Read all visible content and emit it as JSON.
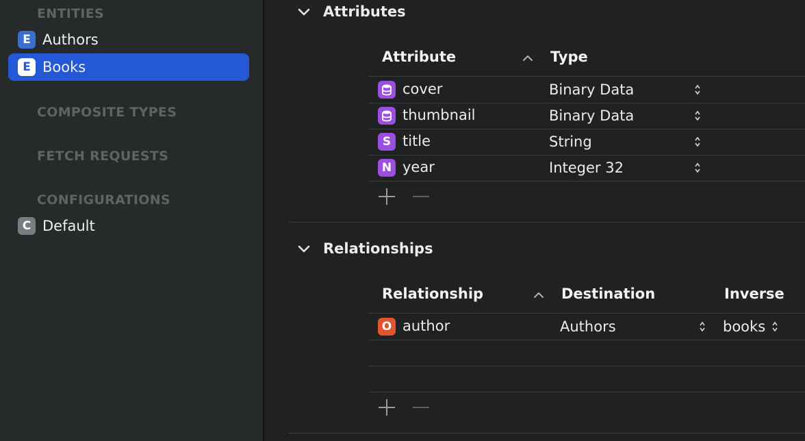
{
  "sidebar": {
    "entities_header": "ENTITIES",
    "entities": [
      {
        "label": "Authors",
        "badge": "E",
        "selected": false
      },
      {
        "label": "Books",
        "badge": "E",
        "selected": true
      }
    ],
    "composite_header": "COMPOSITE TYPES",
    "fetch_header": "FETCH REQUESTS",
    "configurations_header": "CONFIGURATIONS",
    "configurations": [
      {
        "label": "Default",
        "badge": "C"
      }
    ]
  },
  "attributes": {
    "title": "Attributes",
    "col_attribute": "Attribute",
    "col_type": "Type",
    "rows": [
      {
        "name": "cover",
        "type": "Binary Data",
        "icon": "database-icon"
      },
      {
        "name": "thumbnail",
        "type": "Binary Data",
        "icon": "database-icon"
      },
      {
        "name": "title",
        "type": "String",
        "badge": "S"
      },
      {
        "name": "year",
        "type": "Integer 32",
        "badge": "N"
      }
    ]
  },
  "relationships": {
    "title": "Relationships",
    "col_relationship": "Relationship",
    "col_destination": "Destination",
    "col_inverse": "Inverse",
    "rows": [
      {
        "badge": "O",
        "name": "author",
        "destination": "Authors",
        "inverse": "books"
      }
    ]
  },
  "colors": {
    "selection": "#2458d6",
    "attribute_badge": "#9a4fe0",
    "relationship_badge": "#e3532c",
    "entity_badge": "#3a6fd0"
  }
}
